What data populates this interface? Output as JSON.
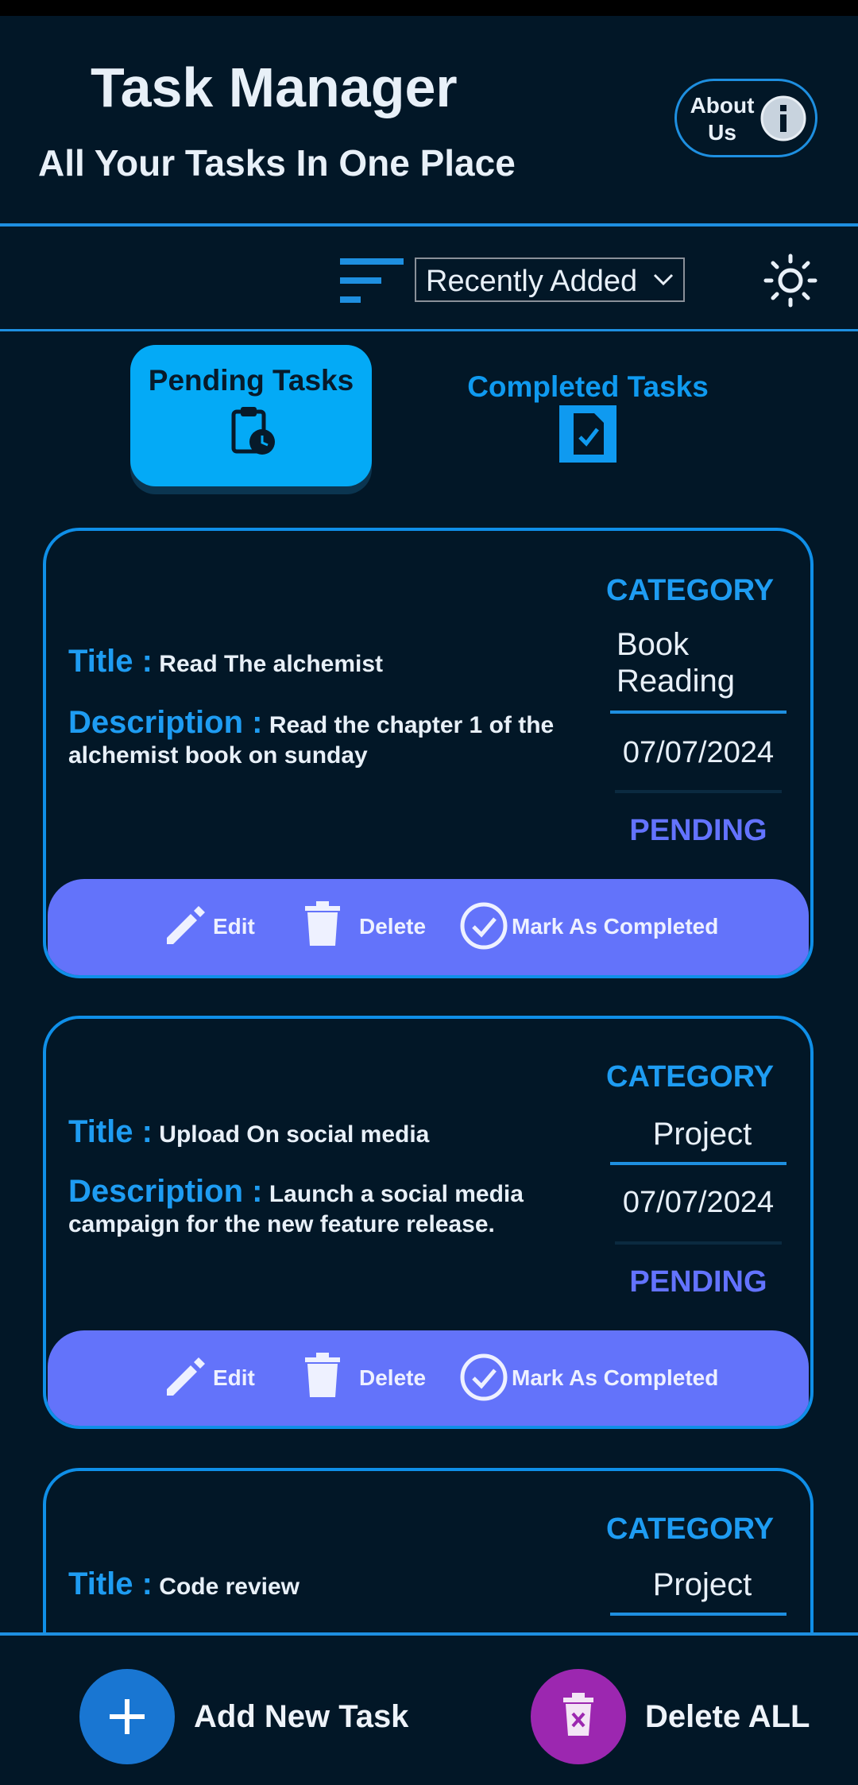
{
  "header": {
    "title": "Task Manager",
    "subtitle": "All Your Tasks In One Place",
    "about_label": "About Us",
    "about_icon": "info-icon"
  },
  "toolbar": {
    "filter_icon": "filter-icon",
    "sort_selected": "Recently Added",
    "theme_icon": "sun-icon"
  },
  "tabs": [
    {
      "label": "Pending Tasks",
      "icon": "clipboard-clock-icon",
      "active": true
    },
    {
      "label": "Completed Tasks",
      "icon": "document-check-icon",
      "active": false
    }
  ],
  "labels": {
    "title": "Title :",
    "description": "Description :",
    "category": "CATEGORY",
    "edit": "Edit",
    "delete": "Delete",
    "mark_completed": "Mark As Completed"
  },
  "tasks": [
    {
      "title": "Read The alchemist",
      "description": "Read the chapter 1 of the alchemist book on sunday",
      "category_line1": "Book",
      "category_line2": "Reading",
      "date": "07/07/2024",
      "status": "PENDING"
    },
    {
      "title": "Upload On social media",
      "description": "Launch a social media campaign for the new feature release.",
      "category_line1": "Project",
      "date": "07/07/2024",
      "status": "PENDING"
    },
    {
      "title": "Code review",
      "category_line1": "Project"
    }
  ],
  "bottom": {
    "add_label": "Add New Task",
    "delete_all_label": "Delete ALL"
  },
  "colors": {
    "background": "#021727",
    "accent": "#1e8fe0",
    "active_tab": "#04aaf6",
    "action_bar": "#6373fa",
    "add_fab": "#1976d2",
    "delete_fab": "#9c27b0"
  }
}
